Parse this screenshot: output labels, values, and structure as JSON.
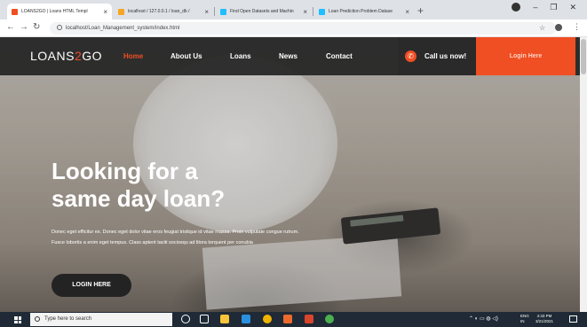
{
  "browser": {
    "tabs": [
      {
        "label": "LOANS2GO | Loans HTML Templ",
        "icon_color": "#f04e23",
        "active": true
      },
      {
        "label": "localhost / 127.0.0.1 / loan_db /",
        "icon_color": "#f5a623",
        "active": false
      },
      {
        "label": "Find Open Datasets and Machin",
        "icon_color": "#20beff",
        "active": false
      },
      {
        "label": "Loan Prediction Problem Datase",
        "icon_color": "#20beff",
        "active": false
      }
    ],
    "url": "localhost/Loan_Management_system/index.html"
  },
  "nav": {
    "logo_prefix": "LOANS",
    "logo_accent": "2",
    "logo_suffix": "GO",
    "links": [
      "Home",
      "About Us",
      "Loans",
      "News",
      "Contact"
    ],
    "call_label": "Call us now!",
    "login_label": "Login Here"
  },
  "hero": {
    "headline_line1": "Looking for a",
    "headline_line2": "same day loan?",
    "blurb": "Donec eget efficitur ex. Donec eget dolor vitae eros feugiat tristique id vitae massa. Proin vulputate congue rutrum. Fusce lobortis a enim eget tempus. Class aptent taciti sociosqu ad litora torquent per conubia",
    "button": "LOGIN HERE"
  },
  "taskbar": {
    "search_placeholder": "Type here to search",
    "language_line1": "ENG",
    "language_line2": "IN",
    "time": "4:33 PM",
    "date": "3/21/2021"
  },
  "colors": {
    "accent": "#f04e23",
    "nav_bg": "#232323",
    "taskbar_bg": "#1f2a36"
  }
}
